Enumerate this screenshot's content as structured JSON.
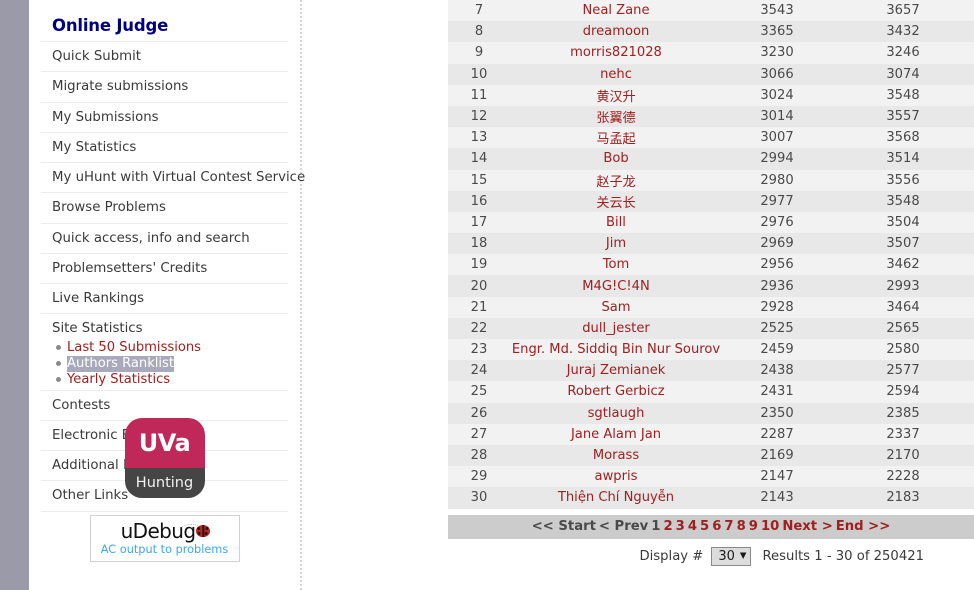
{
  "sidebar": {
    "title": "Online Judge",
    "items": [
      {
        "label": "Quick Submit"
      },
      {
        "label": "Migrate submissions"
      },
      {
        "label": "My Submissions"
      },
      {
        "label": "My Statistics"
      },
      {
        "label": "My uHunt with Virtual Contest Service"
      },
      {
        "label": "Browse Problems"
      },
      {
        "label": "Quick access, info and search"
      },
      {
        "label": "Problemsetters' Credits"
      },
      {
        "label": "Live Rankings"
      }
    ],
    "stats_group": {
      "label": "Site Statistics",
      "sub_items": [
        {
          "label": "Last 50 Submissions",
          "selected": false
        },
        {
          "label": "Authors Ranklist",
          "selected": true
        },
        {
          "label": "Yearly Statistics",
          "selected": false
        }
      ]
    },
    "items_after": [
      {
        "label": "Contests"
      },
      {
        "label": "Electronic Board"
      },
      {
        "label": "Additional Information"
      },
      {
        "label": "Other Links"
      }
    ],
    "logos": {
      "uva": {
        "top_text": "UVa",
        "bottom_text": "Hunting",
        "top_color": "#c1285a",
        "bottom_color": "#454545"
      },
      "udebug": {
        "word": "uDebug",
        "subtitle": "AC output to problems",
        "subtitle_color": "#3aa9ef"
      }
    }
  },
  "table": {
    "rows": [
      {
        "rank": "7",
        "name": "Neal Zane",
        "solved": "3543",
        "subs": "3657"
      },
      {
        "rank": "8",
        "name": "dreamoon",
        "solved": "3365",
        "subs": "3432"
      },
      {
        "rank": "9",
        "name": "morris821028",
        "solved": "3230",
        "subs": "3246"
      },
      {
        "rank": "10",
        "name": "nehc",
        "solved": "3066",
        "subs": "3074"
      },
      {
        "rank": "11",
        "name": "黄汉升",
        "solved": "3024",
        "subs": "3548"
      },
      {
        "rank": "12",
        "name": "张翼德",
        "solved": "3014",
        "subs": "3557"
      },
      {
        "rank": "13",
        "name": "马孟起",
        "solved": "3007",
        "subs": "3568"
      },
      {
        "rank": "14",
        "name": "Bob",
        "solved": "2994",
        "subs": "3514"
      },
      {
        "rank": "15",
        "name": "赵子龙",
        "solved": "2980",
        "subs": "3556"
      },
      {
        "rank": "16",
        "name": "关云长",
        "solved": "2977",
        "subs": "3548"
      },
      {
        "rank": "17",
        "name": "Bill",
        "solved": "2976",
        "subs": "3504"
      },
      {
        "rank": "18",
        "name": "Jim",
        "solved": "2969",
        "subs": "3507"
      },
      {
        "rank": "19",
        "name": "Tom",
        "solved": "2956",
        "subs": "3462"
      },
      {
        "rank": "20",
        "name": "M4G!C!4N",
        "solved": "2936",
        "subs": "2993"
      },
      {
        "rank": "21",
        "name": "Sam",
        "solved": "2928",
        "subs": "3464"
      },
      {
        "rank": "22",
        "name": "dull_jester",
        "solved": "2525",
        "subs": "2565"
      },
      {
        "rank": "23",
        "name": "Engr. Md. Siddiq Bin Nur Sourov",
        "solved": "2459",
        "subs": "2580"
      },
      {
        "rank": "24",
        "name": "Juraj Zemianek",
        "solved": "2438",
        "subs": "2577"
      },
      {
        "rank": "25",
        "name": "Robert Gerbicz",
        "solved": "2431",
        "subs": "2594"
      },
      {
        "rank": "26",
        "name": "sgtlaugh",
        "solved": "2350",
        "subs": "2385"
      },
      {
        "rank": "27",
        "name": "Jane Alam Jan",
        "solved": "2287",
        "subs": "2337"
      },
      {
        "rank": "28",
        "name": "Morass",
        "solved": "2169",
        "subs": "2170"
      },
      {
        "rank": "29",
        "name": "awpris",
        "solved": "2147",
        "subs": "2228"
      },
      {
        "rank": "30",
        "name": "Thiện Chí Nguyễn",
        "solved": "2143",
        "subs": "2183"
      }
    ]
  },
  "pagination": {
    "items": [
      {
        "label": "<< Start",
        "link": false
      },
      {
        "label": "< Prev",
        "link": false
      },
      {
        "label": "1",
        "link": false
      },
      {
        "label": "2",
        "link": true
      },
      {
        "label": "3",
        "link": true
      },
      {
        "label": "4",
        "link": true
      },
      {
        "label": "5",
        "link": true
      },
      {
        "label": "6",
        "link": true
      },
      {
        "label": "7",
        "link": true
      },
      {
        "label": "8",
        "link": true
      },
      {
        "label": "9",
        "link": true
      },
      {
        "label": "10",
        "link": true
      },
      {
        "label": "Next >",
        "link": true
      },
      {
        "label": "End >>",
        "link": true
      }
    ]
  },
  "footer": {
    "display_label": "Display #",
    "display_value": "30",
    "results_text": "Results 1 - 30 of 250421"
  }
}
